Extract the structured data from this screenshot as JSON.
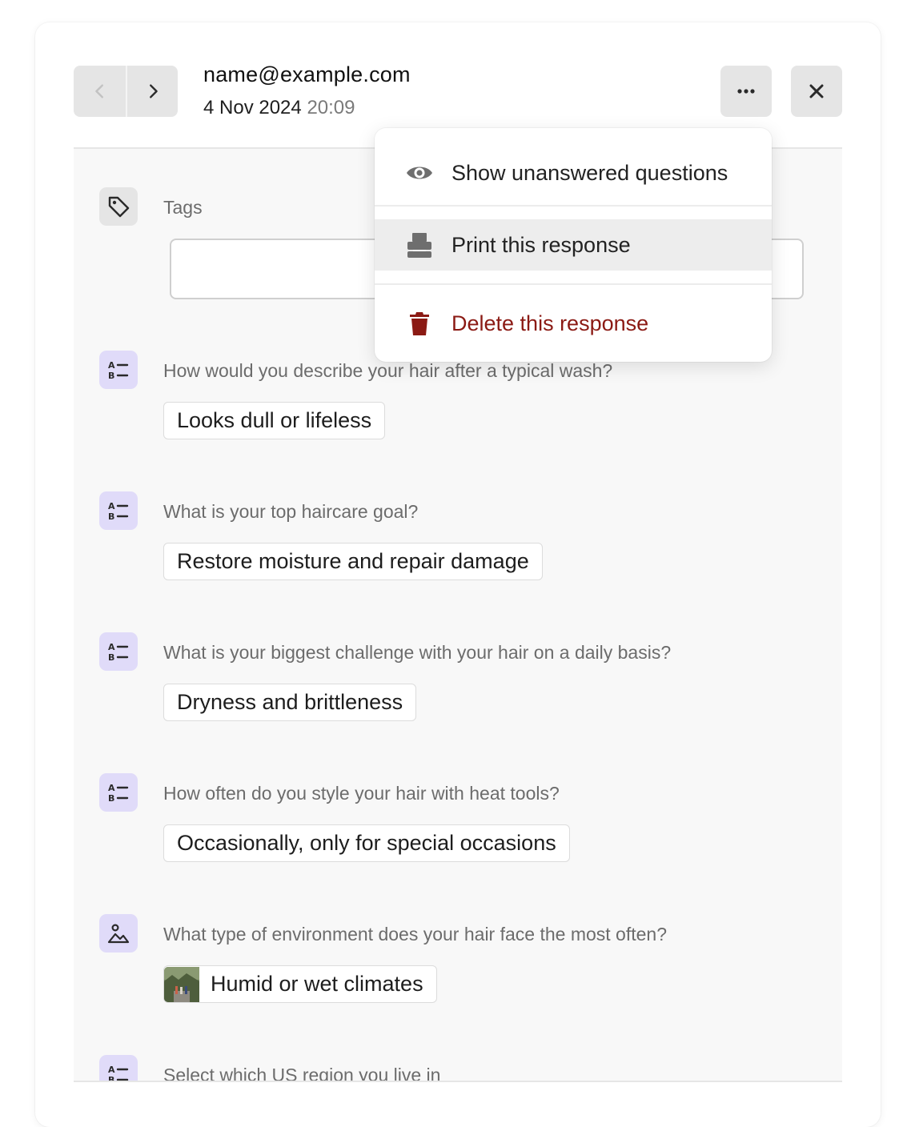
{
  "header": {
    "email": "name@example.com",
    "date": "4 Nov 2024",
    "time": "20:09"
  },
  "icons": {
    "prev": "chevron-left-icon",
    "next": "chevron-right-icon",
    "more": "ellipsis-icon",
    "close": "close-icon"
  },
  "menu": {
    "items": [
      {
        "label": "Show unanswered questions",
        "icon": "eye-icon"
      },
      {
        "label": "Print this response",
        "icon": "printer-icon"
      },
      {
        "label": "Delete this response",
        "icon": "trash-icon"
      }
    ],
    "danger_color": "#8b1a14"
  },
  "tags": {
    "label": "Tags",
    "value": ""
  },
  "questions": [
    {
      "label": "How would you describe your hair after a typical wash?",
      "answer": "Looks dull or lifeless",
      "type": "multiple-choice-icon"
    },
    {
      "label": "What is your top haircare goal?",
      "answer": "Restore moisture and repair damage",
      "type": "multiple-choice-icon"
    },
    {
      "label": "What is your biggest challenge with your hair on a daily basis?",
      "answer": "Dryness and brittleness",
      "type": "multiple-choice-icon"
    },
    {
      "label": "How often do you style your hair with heat tools?",
      "answer": "Occasionally, only for special occasions",
      "type": "multiple-choice-icon"
    },
    {
      "label": "What type of environment does your hair face the most often?",
      "answer": "Humid or wet climates",
      "type": "picture-choice-icon"
    },
    {
      "label": "Select which US region you live in",
      "answer": "",
      "type": "multiple-choice-icon"
    }
  ],
  "colors": {
    "accent_icon_bg": "#e0dbf9",
    "button_bg": "#e5e5e5"
  }
}
